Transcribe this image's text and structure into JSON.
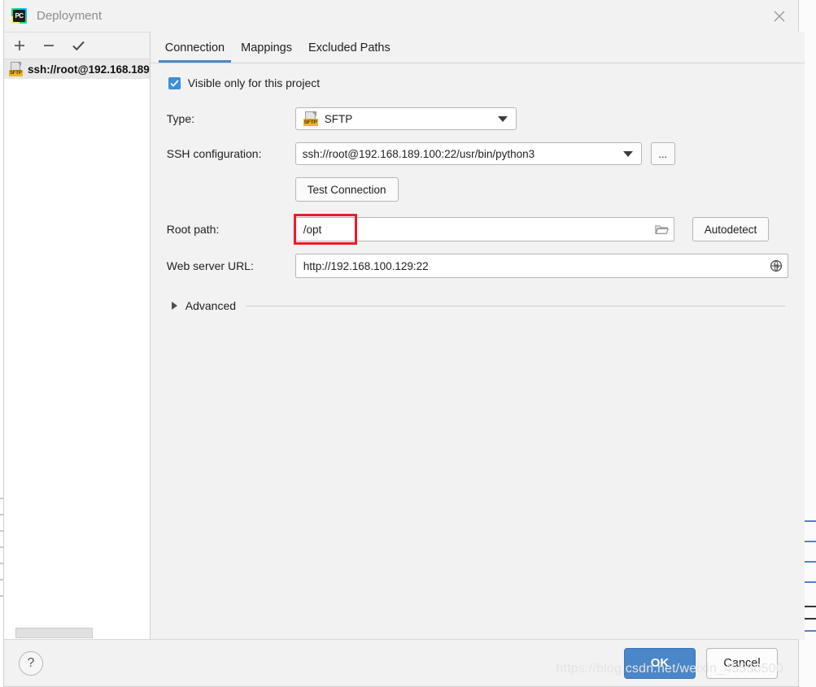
{
  "window": {
    "title": "Deployment",
    "logo_text": "PC",
    "close_icon": "close-icon"
  },
  "tree_toolbar": {
    "add_label": "+",
    "remove_label": "−",
    "apply_label": "✓"
  },
  "tree": {
    "items": [
      {
        "label": "ssh://root@192.168.189",
        "icon": "sftp-file-icon",
        "selected": true
      }
    ]
  },
  "tabs": [
    {
      "label": "Connection",
      "active": true
    },
    {
      "label": "Mappings",
      "active": false
    },
    {
      "label": "Excluded Paths",
      "active": false
    }
  ],
  "form": {
    "visible_only_checkbox": {
      "label": "Visible only for this project",
      "checked": true,
      "accent_color": "#3c8fd8"
    },
    "type": {
      "label": "Type:",
      "value": "SFTP",
      "icon": "sftp-file-icon",
      "icon_badge": "SFTP"
    },
    "ssh_configuration": {
      "label": "SSH configuration:",
      "value_prefix": "ssh://root@",
      "value_highlight": "192.168.189.100:22",
      "value_suffix": "/usr/bin/python3",
      "full_value": "ssh://root@192.168.189.100:22/usr/bin/python3",
      "highlight_color": "#ee1c24",
      "browse_label": "..."
    },
    "test_connection": {
      "label": "Test Connection"
    },
    "root_path": {
      "label": "Root path:",
      "value": "/opt",
      "highlight_color": "#ee1c24",
      "browse_icon": "folder-icon",
      "autodetect_label": "Autodetect"
    },
    "web_server_url": {
      "label": "Web server URL:",
      "value": "http://192.168.100.129:22",
      "trailing_icon": "globe-icon"
    },
    "advanced": {
      "label": "Advanced",
      "expanded": false,
      "arrow_icon": "chevron-right-icon"
    }
  },
  "footer": {
    "help_label": "?",
    "ok_label": "OK",
    "cancel_label": "Cancel",
    "ok_color": "#4a86c8"
  },
  "watermark": {
    "text": "https://blog.csdn.net/weixin_45550500"
  }
}
